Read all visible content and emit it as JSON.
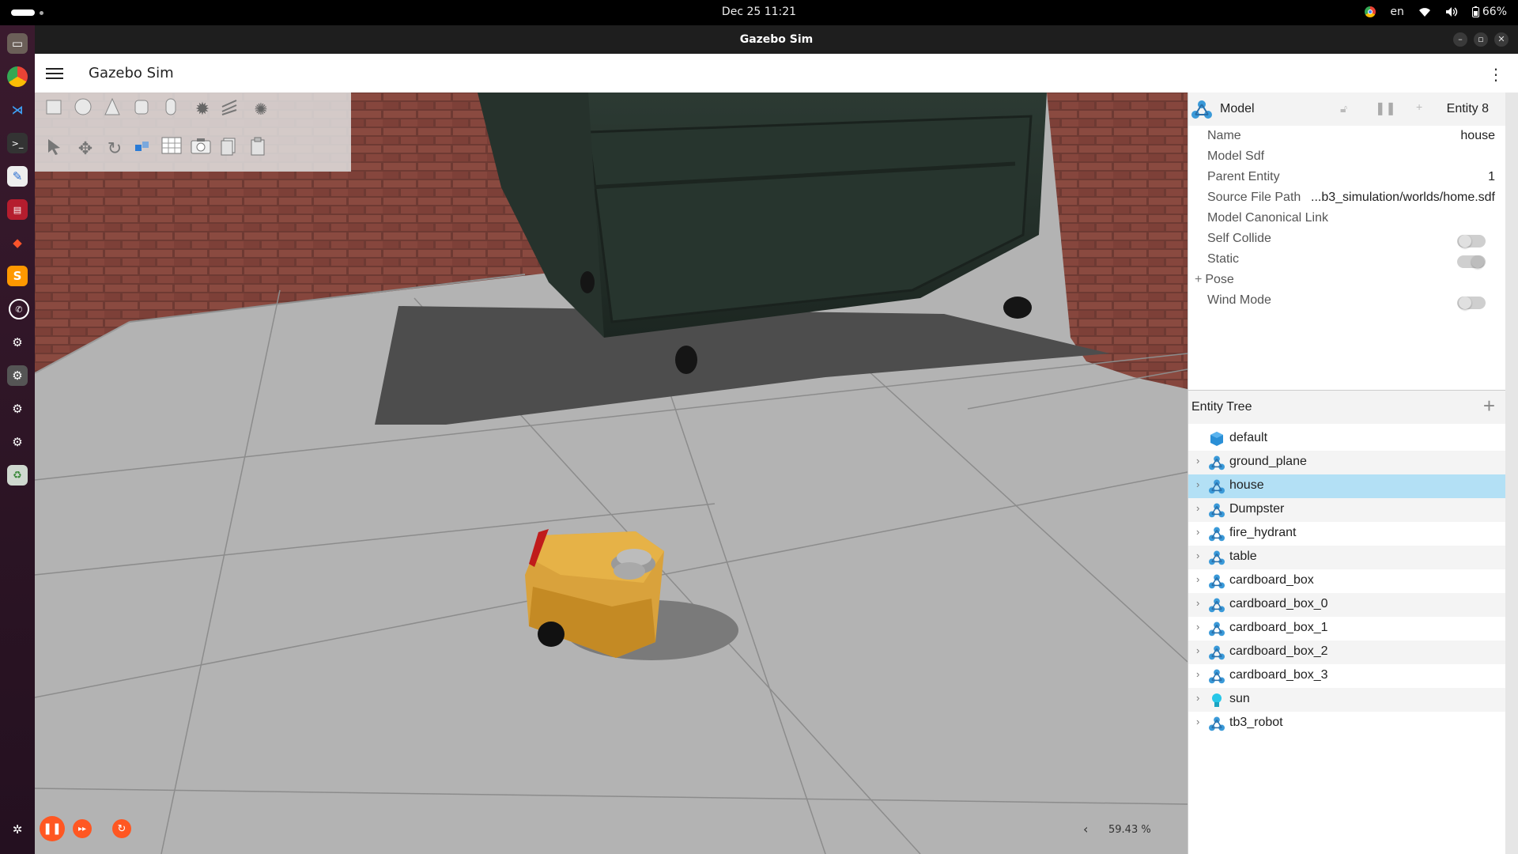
{
  "system": {
    "clock": "Dec 25  11:21",
    "language": "en",
    "battery": "66%"
  },
  "window": {
    "title": "Gazebo Sim"
  },
  "app": {
    "title": "Gazebo Sim"
  },
  "toolbar": {
    "row1": [
      "box-icon",
      "sphere-icon",
      "cone-icon",
      "cylinder-icon",
      "capsule-icon",
      "sun-light-icon",
      "directional-light-icon",
      "spot-light-icon"
    ],
    "row2": [
      "select-icon",
      "translate-icon",
      "rotate-icon",
      "snap-icon",
      "grid-icon",
      "camera-icon",
      "copy-icon",
      "paste-icon"
    ]
  },
  "playback": {
    "rtf_value": "59.43 %",
    "chevron": "‹"
  },
  "component_inspector": {
    "type": "Model",
    "entity_label": "Entity 8",
    "properties": [
      {
        "label": "Name",
        "value": "house"
      },
      {
        "label": "Model Sdf",
        "value": ""
      },
      {
        "label": "Parent Entity",
        "value": "1"
      },
      {
        "label": "Source File Path",
        "value": "...b3_simulation/worlds/home.sdf"
      },
      {
        "label": "Model Canonical Link",
        "value": ""
      },
      {
        "label": "Self Collide",
        "value": ""
      },
      {
        "label": "Static",
        "value": ""
      },
      {
        "label": "Pose",
        "value": ""
      },
      {
        "label": "Wind Mode",
        "value": ""
      }
    ],
    "pose_expand": "+",
    "self_collide": false,
    "static": true,
    "wind_mode": false
  },
  "entity_tree": {
    "title": "Entity Tree",
    "add": "+",
    "chevron": "›",
    "items": [
      {
        "label": "default",
        "icon": "world-icon"
      },
      {
        "label": "ground_plane",
        "icon": "model-icon"
      },
      {
        "label": "house",
        "icon": "model-icon"
      },
      {
        "label": "Dumpster",
        "icon": "model-icon"
      },
      {
        "label": "fire_hydrant",
        "icon": "model-icon"
      },
      {
        "label": "table",
        "icon": "model-icon"
      },
      {
        "label": "cardboard_box",
        "icon": "model-icon"
      },
      {
        "label": "cardboard_box_0",
        "icon": "model-icon"
      },
      {
        "label": "cardboard_box_1",
        "icon": "model-icon"
      },
      {
        "label": "cardboard_box_2",
        "icon": "model-icon"
      },
      {
        "label": "cardboard_box_3",
        "icon": "model-icon"
      },
      {
        "label": "sun",
        "icon": "light-bulb-icon"
      },
      {
        "label": "tb3_robot",
        "icon": "model-icon"
      }
    ],
    "selected": "house"
  },
  "colors": {
    "accent_orange": "#ff5722",
    "selection": "#b3e0f5",
    "robot_body": "#e0a83a"
  }
}
